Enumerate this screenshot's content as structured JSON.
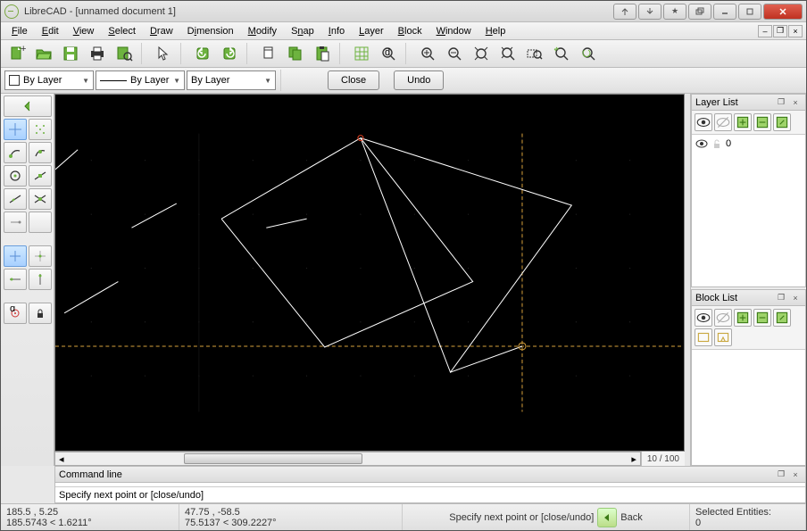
{
  "window": {
    "title": "LibreCAD - [unnamed document 1]"
  },
  "menu": {
    "file": "File",
    "edit": "Edit",
    "view": "View",
    "select": "Select",
    "draw": "Draw",
    "dimension": "Dimension",
    "modify": "Modify",
    "snap": "Snap",
    "info": "Info",
    "layer": "Layer",
    "block": "Block",
    "windowm": "Window",
    "help": "Help"
  },
  "combos": {
    "colorByLayer": "By Layer",
    "widthByLayer": "By Layer",
    "linetypeByLayer": "By Layer"
  },
  "buttons": {
    "close": "Close",
    "undo": "Undo"
  },
  "zoom": "10 / 100",
  "panels": {
    "layerList": "Layer List",
    "blockList": "Block List",
    "commandLine": "Command line"
  },
  "layers": {
    "items": [
      {
        "name": "0",
        "visible": true,
        "locked": false
      }
    ]
  },
  "command": {
    "prompt": "Specify next point or [close/undo]"
  },
  "status": {
    "coord1a": "185.5 , 5.25",
    "coord1b": "185.5743 < 1.6211°",
    "coord2a": "47.75 , -58.5",
    "coord2b": "75.5137 < 309.2227°",
    "promptLabel": "Specify next point or [close/undo]",
    "back": "Back",
    "selLabel": "Selected Entities:",
    "selCount": "0"
  }
}
